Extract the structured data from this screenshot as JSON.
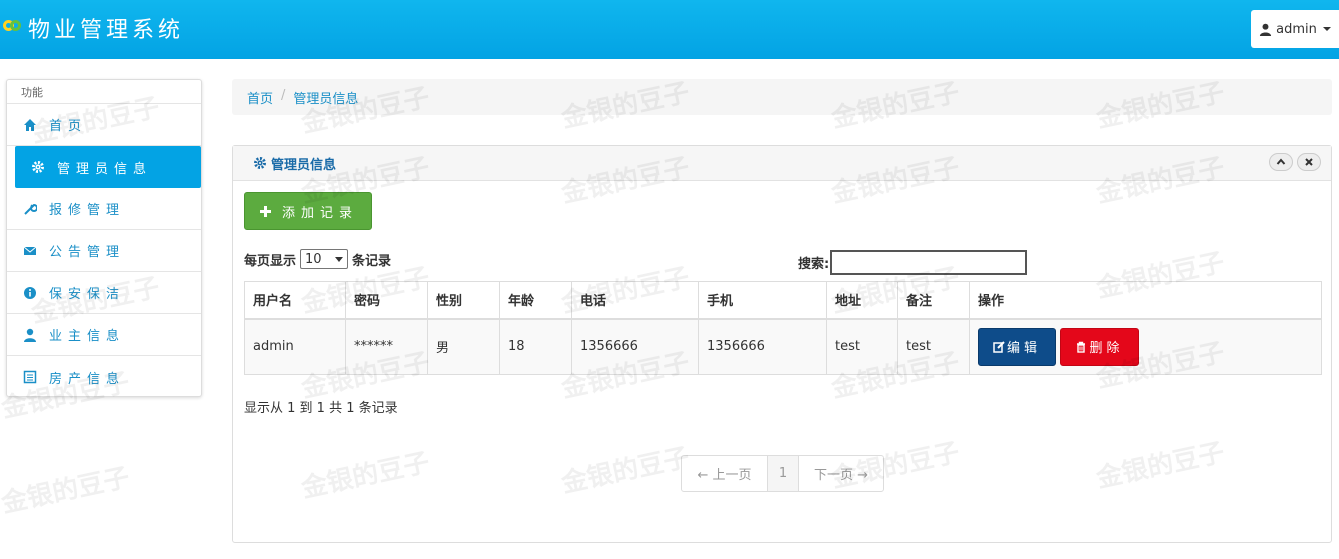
{
  "header": {
    "title": "物业管理系统",
    "user": "admin"
  },
  "sidebar": {
    "heading": "功能",
    "items": [
      {
        "label": "首页",
        "icon": "home-icon"
      },
      {
        "label": "管理员信息",
        "icon": "gear-icon"
      },
      {
        "label": "报修管理",
        "icon": "wrench-icon"
      },
      {
        "label": "公告管理",
        "icon": "envelope-icon"
      },
      {
        "label": "保安保洁",
        "icon": "info-icon"
      },
      {
        "label": "业主信息",
        "icon": "user-icon"
      },
      {
        "label": "房产信息",
        "icon": "list-icon"
      }
    ]
  },
  "breadcrumb": {
    "home": "首页",
    "current": "管理员信息"
  },
  "panel": {
    "title": "管理员信息"
  },
  "toolbar": {
    "add_label": "添加记录"
  },
  "table_controls": {
    "per_page_prefix": "每页显示",
    "per_page_value": "10",
    "per_page_suffix": "条记录",
    "search_label": "搜索:"
  },
  "table": {
    "headers": [
      "用户名",
      "密码",
      "性别",
      "年龄",
      "电话",
      "手机",
      "地址",
      "备注",
      "操作"
    ],
    "rows": [
      {
        "username": "admin",
        "password": "******",
        "gender": "男",
        "age": "18",
        "phone": "1356666",
        "mobile": "1356666",
        "address": "test",
        "note": "test",
        "edit": "编辑",
        "delete": "删除"
      }
    ]
  },
  "info": "显示从 1 到 1 共 1 条记录",
  "pagination": {
    "prev": "← 上一页",
    "page": "1",
    "next": "下一页 →"
  },
  "watermark": "金银的豆子",
  "colors": {
    "header": "#03a3e4",
    "active": "#03a3e4",
    "add": "#5cab3f",
    "edit": "#0e4c8a",
    "delete": "#e4071a"
  }
}
